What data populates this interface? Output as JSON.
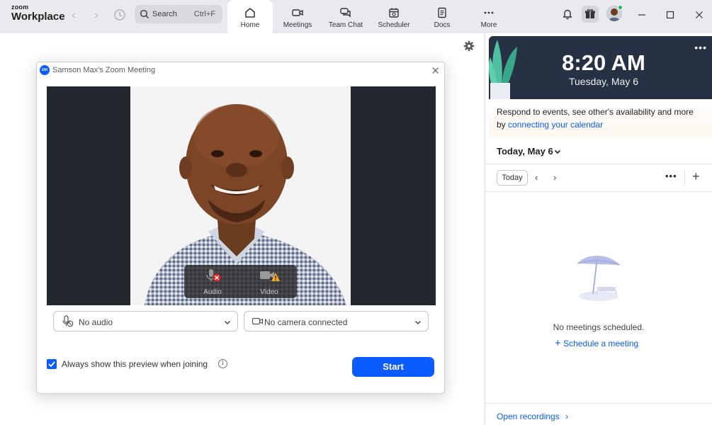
{
  "topbar": {
    "logo_small": "zoom",
    "logo_large": "Workplace",
    "search_label": "Search",
    "search_shortcut": "Ctrl+F",
    "tabs": [
      {
        "label": "Home",
        "icon": "home-icon",
        "active": true
      },
      {
        "label": "Meetings",
        "icon": "video-camera-icon",
        "active": false
      },
      {
        "label": "Team Chat",
        "icon": "chat-icon",
        "active": false
      },
      {
        "label": "Scheduler",
        "icon": "calendar-icon",
        "active": false
      },
      {
        "label": "Docs",
        "icon": "document-icon",
        "active": false
      },
      {
        "label": "More",
        "icon": "more-dots-icon",
        "active": false
      }
    ]
  },
  "dialog": {
    "title": "Samson Max's Zoom Meeting",
    "audio_label": "Audio",
    "video_label": "Video",
    "audio_select": "No audio",
    "camera_select": "No camera connected",
    "checkbox_label": "Always show this preview when joining",
    "checkbox_checked": true,
    "start_label": "Start"
  },
  "right_panel": {
    "time": "8:20 AM",
    "date": "Tuesday, May 6",
    "respond_line1": "Respond to events, see other's availability and more",
    "respond_prefix": "by ",
    "respond_link": "connecting your calendar",
    "day_header": "Today, May 6",
    "today_button": "Today",
    "no_meetings": "No meetings scheduled.",
    "schedule_link": "Schedule a meeting",
    "open_recordings": "Open recordings"
  },
  "colors": {
    "accent": "#0b5cff",
    "clock_bg": "#263243",
    "topbar_bg": "#e9eaed",
    "status_online": "#1db954"
  }
}
